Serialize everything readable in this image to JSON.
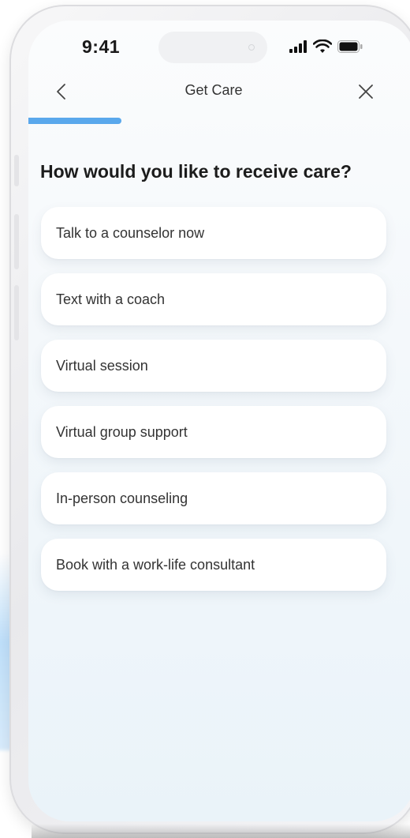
{
  "status_bar": {
    "time": "9:41",
    "icons": [
      "signal-bars-icon",
      "wifi-icon",
      "battery-icon"
    ]
  },
  "nav": {
    "title": "Get Care",
    "back_icon": "chevron-left-icon",
    "close_icon": "close-icon"
  },
  "progress": {
    "fraction": 0.25,
    "color": "#5aa8ec"
  },
  "question": "How would you like to receive care?",
  "options": [
    {
      "label": "Talk to a counselor now"
    },
    {
      "label": "Text with a coach"
    },
    {
      "label": "Virtual session"
    },
    {
      "label": "Virtual group support"
    },
    {
      "label": "In-person counseling"
    },
    {
      "label": "Book with a work-life consultant"
    }
  ]
}
